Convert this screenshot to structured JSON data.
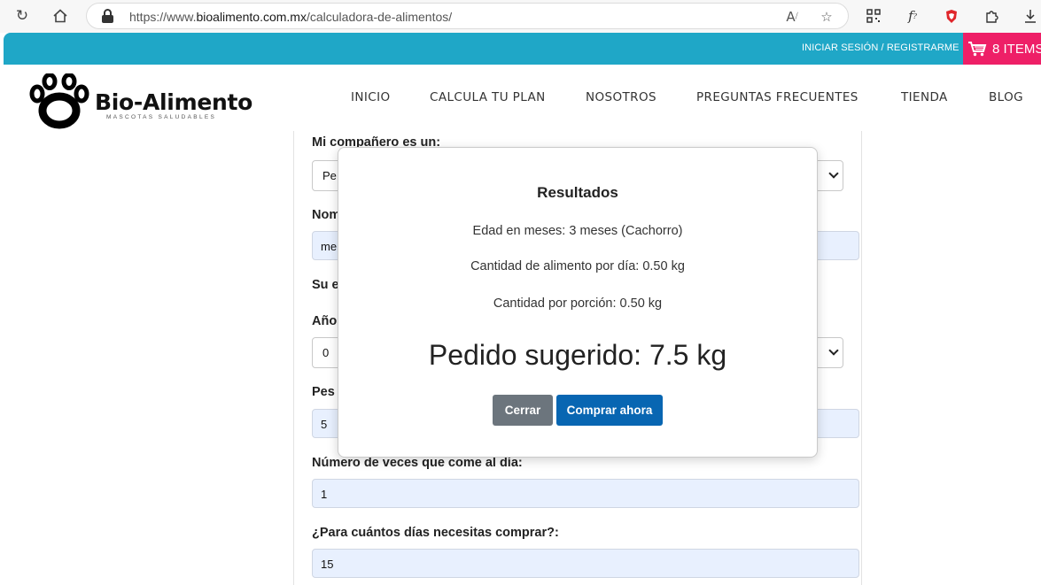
{
  "browser": {
    "url_prefix": "https://www.",
    "url_domain": "bioalimento.com.mx",
    "url_path": "/calculadora-de-alimentos/"
  },
  "topbar": {
    "login_label": "INICIAR SESIÓN / REGISTRARME",
    "cart_label": "8 ITEMS",
    "bar_color": "#1fa7c7",
    "cart_color": "#ee1f67"
  },
  "header": {
    "logo_name": "Bio-Alimento",
    "logo_tagline": "MASCOTAS SALUDABLES",
    "menu": [
      "INICIO",
      "CALCULA TU PLAN",
      "NOSOTROS",
      "PREGUNTAS FRECUENTES",
      "TIENDA",
      "BLOG"
    ]
  },
  "form": {
    "companion_label": "Mi compañero es un:",
    "companion_value": "Pe",
    "name_label": "Nom",
    "name_value": "me",
    "stage_label": "Su e",
    "years_label": "Año",
    "years_value": "0",
    "weight_label": "Pes",
    "weight_value": "5",
    "meals_label": "Número de veces que come al día:",
    "meals_value": "1",
    "days_label": "¿Para cuántos días necesitas comprar?:",
    "days_value": "15"
  },
  "modal": {
    "title": "Resultados",
    "age_line": "Edad en meses: 3 meses (Cachorro)",
    "food_line": "Cantidad de alimento por día: 0.50 kg",
    "portion_line": "Cantidad por porción: 0.50 kg",
    "suggestion": "Pedido sugerido: 7.5 kg",
    "close_label": "Cerrar",
    "buy_label": "Comprar ahora"
  }
}
